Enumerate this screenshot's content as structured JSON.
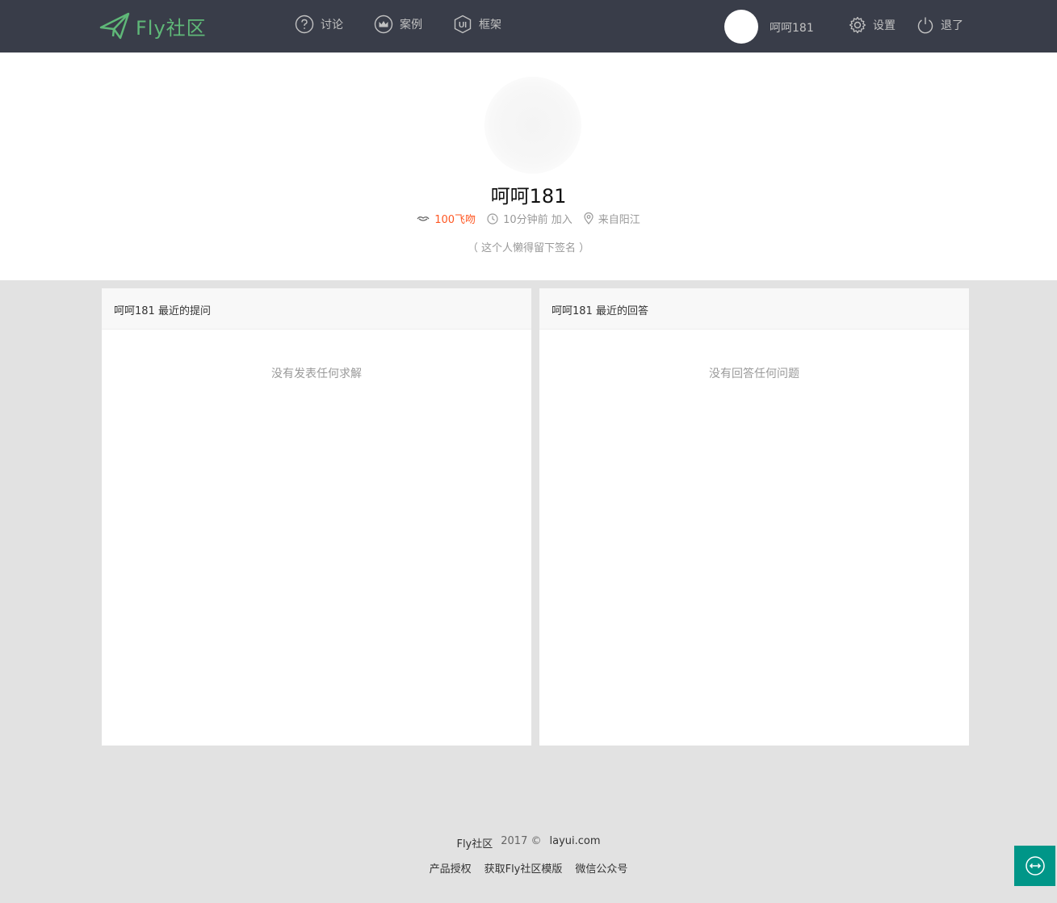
{
  "header": {
    "logo_text": "Fly社区",
    "nav": [
      {
        "label": "讨论",
        "icon": "question-circle-icon"
      },
      {
        "label": "案例",
        "icon": "crown-icon"
      },
      {
        "label": "框架",
        "icon": "ui-shield-icon"
      }
    ],
    "user_name": "呵呵181",
    "settings_label": "设置",
    "logout_label": "退了"
  },
  "profile": {
    "name": "呵呵181",
    "kiss": "100飞吻",
    "joined": "10分钟前 加入",
    "location": "来自阳江",
    "signature": "（ 这个人懒得留下签名 ）"
  },
  "panels": {
    "questions_title": "呵呵181 最近的提问",
    "questions_empty": "没有发表任何求解",
    "answers_title": "呵呵181 最近的回答",
    "answers_empty": "没有回答任何问题"
  },
  "footer": {
    "brand": "Fly社区",
    "year": "2017 ©",
    "site": "layui.com",
    "links": [
      "产品授权",
      "获取Fly社区模版",
      "微信公众号"
    ]
  },
  "colors": {
    "header_bg": "#393d49",
    "logo": "#5fb878",
    "kiss": "#ff5722",
    "float_btn": "#009688",
    "page_bg": "#e2e2e2"
  }
}
